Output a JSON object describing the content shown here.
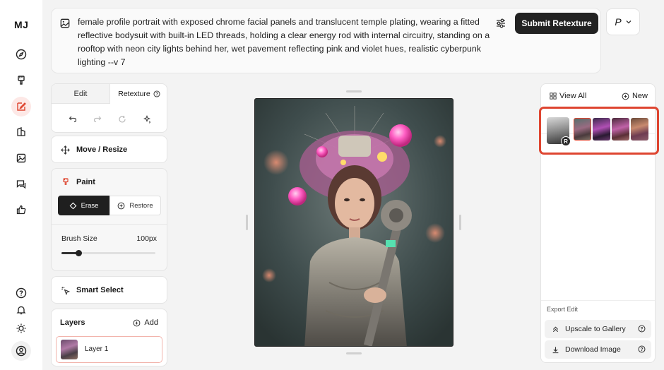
{
  "app": {
    "logo": "MJ"
  },
  "prompt": {
    "text": "female profile portrait with exposed chrome facial panels and translucent temple plating, wearing a fitted reflective bodysuit with built-in LED threads, holding a clear energy rod with internal circuitry, standing on a rooftop with neon city lights behind her, wet pavement reflecting pink and violet hues, realistic cyberpunk lighting --v 7",
    "submit_label": "Submit Retexture",
    "profile_label": "P"
  },
  "tabs": {
    "edit": "Edit",
    "retexture": "Retexture"
  },
  "panels": {
    "move_resize": "Move / Resize",
    "paint": "Paint",
    "erase": "Erase",
    "restore": "Restore",
    "brush_size_label": "Brush Size",
    "brush_size_value": "100px",
    "brush_size_fraction": 0.18,
    "smart_select": "Smart Select",
    "layers_label": "Layers",
    "add_label": "Add",
    "layer_name": "Layer 1"
  },
  "right": {
    "view_all": "View All",
    "new": "New",
    "ref_badge": "R",
    "export_label": "Export Edit",
    "upscale": "Upscale to Gallery",
    "download": "Download Image"
  },
  "colors": {
    "accent": "#de4530",
    "dark": "#1f1f1f"
  }
}
